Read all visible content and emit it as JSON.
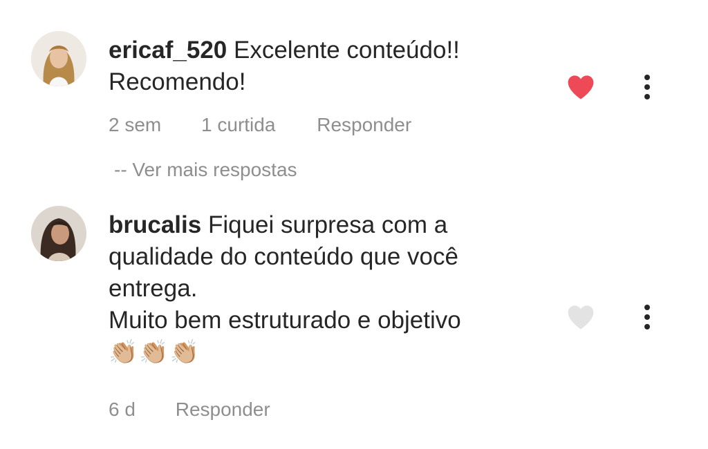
{
  "comments": [
    {
      "username": "ericaf_520",
      "text": "Excelente conteúdo!!",
      "text_line2": "Recomendo!",
      "time": "2 sem",
      "likes": "1 curtida",
      "reply_label": "Responder",
      "liked": true,
      "heart_color": "#ed4956"
    },
    {
      "username": "brucalis",
      "text_lines": [
        "Fiquei surpresa com a",
        "qualidade do conteúdo que você",
        "entrega.",
        "Muito bem estruturado e objetivo"
      ],
      "emoji": "👏🏼👏🏼👏🏼",
      "time": "6 d",
      "reply_label": "Responder",
      "liked": false,
      "heart_color": "#dbdbdb"
    }
  ],
  "view_more_replies": "-- Ver mais respostas",
  "colors": {
    "text": "#262626",
    "secondary": "#8e8e8e",
    "liked_heart": "#ed4956",
    "unliked_heart": "#dbdbdb"
  }
}
